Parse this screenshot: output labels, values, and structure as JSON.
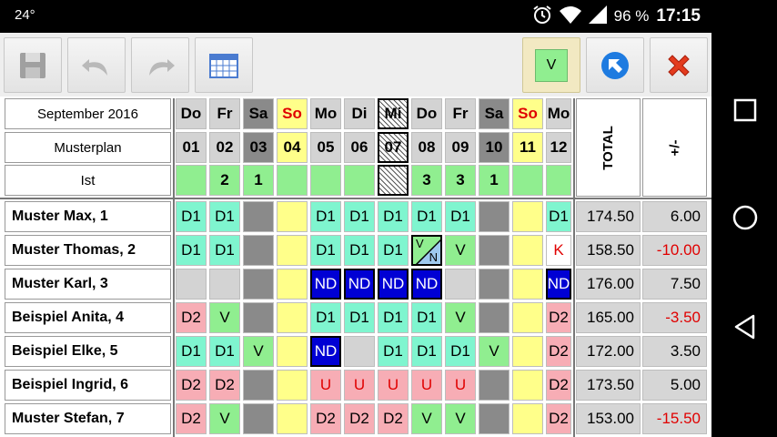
{
  "status_bar": {
    "temperature": "24°",
    "battery": "96 %",
    "time": "17:15",
    "icons": [
      "alarm-icon",
      "wifi-icon",
      "signal-icon"
    ]
  },
  "toolbar": {
    "buttons": [
      "save-icon",
      "undo-icon",
      "redo-icon",
      "calendar-icon"
    ],
    "shift_selector": "V",
    "right_buttons": [
      "back-arrow-icon",
      "close-icon"
    ]
  },
  "header": {
    "month": "September 2016",
    "plan": "Musterplan",
    "actual": "Ist",
    "total_label": "TOTAL",
    "diff_label": "+/-"
  },
  "days": [
    {
      "wd": "Do",
      "num": "01",
      "ist": "",
      "type": "normal"
    },
    {
      "wd": "Fr",
      "num": "02",
      "ist": "2",
      "type": "normal"
    },
    {
      "wd": "Sa",
      "num": "03",
      "ist": "1",
      "type": "sat"
    },
    {
      "wd": "So",
      "num": "04",
      "ist": "",
      "type": "sun"
    },
    {
      "wd": "Mo",
      "num": "05",
      "ist": "",
      "type": "normal"
    },
    {
      "wd": "Di",
      "num": "06",
      "ist": "",
      "type": "normal"
    },
    {
      "wd": "Mi",
      "num": "07",
      "ist": "",
      "type": "holiday"
    },
    {
      "wd": "Do",
      "num": "08",
      "ist": "3",
      "type": "normal"
    },
    {
      "wd": "Fr",
      "num": "09",
      "ist": "3",
      "type": "normal"
    },
    {
      "wd": "Sa",
      "num": "10",
      "ist": "1",
      "type": "sat"
    },
    {
      "wd": "So",
      "num": "11",
      "ist": "",
      "type": "sun"
    },
    {
      "wd": "Mo",
      "num": "12",
      "ist": "",
      "type": "normal"
    }
  ],
  "employees": [
    {
      "name": "Muster Max, 1",
      "total": "174.50",
      "diff": "6.00",
      "cells": [
        "D1",
        "D1",
        "",
        "",
        "D1",
        "D1",
        "D1",
        "D1",
        "D1",
        "",
        "",
        "D1"
      ]
    },
    {
      "name": "Muster Thomas, 2",
      "total": "158.50",
      "diff": "-10.00",
      "cells": [
        "D1",
        "D1",
        "",
        "",
        "D1",
        "D1",
        "D1",
        "V/N",
        "V",
        "",
        "",
        "K"
      ]
    },
    {
      "name": "Muster Karl, 3",
      "total": "176.00",
      "diff": "7.50",
      "cells": [
        "",
        "",
        "",
        "",
        "ND",
        "ND",
        "ND",
        "ND",
        "",
        "",
        "",
        "ND"
      ]
    },
    {
      "name": "Beispiel Anita, 4",
      "total": "165.00",
      "diff": "-3.50",
      "cells": [
        "D2",
        "V",
        "",
        "",
        "D1",
        "D1",
        "D1",
        "D1",
        "V",
        "",
        "",
        "D2"
      ]
    },
    {
      "name": "Beispiel Elke, 5",
      "total": "172.00",
      "diff": "3.50",
      "cells": [
        "D1",
        "D1",
        "V",
        "",
        "ND",
        "",
        "D1",
        "D1",
        "D1",
        "V",
        "",
        "D2"
      ]
    },
    {
      "name": "Beispiel Ingrid, 6",
      "total": "173.50",
      "diff": "5.00",
      "cells": [
        "D2",
        "D2",
        "",
        "",
        "U",
        "U",
        "U",
        "U",
        "U",
        "",
        "",
        "D2"
      ]
    },
    {
      "name": "Muster Stefan, 7",
      "total": "153.00",
      "diff": "-15.50",
      "cells": [
        "D2",
        "V",
        "",
        "",
        "D2",
        "D2",
        "D2",
        "V",
        "V",
        "",
        "",
        "D2"
      ]
    }
  ],
  "colors": {
    "D1": "#7ff5cf",
    "D2": "#f7adb5",
    "V": "#90ee90",
    "ND": "#0000d4",
    "U": "#f7adb5",
    "K": "#ffffff",
    "sat": "#8a8a8a",
    "sun": "#ffff8a",
    "normal_empty": "#d3d3d3",
    "header_normal": "#d3d3d3",
    "ist_bg": "#90ee90",
    "U_text": "#e00000",
    "K_text": "#e00000",
    "ND_text": "#ffffff"
  }
}
